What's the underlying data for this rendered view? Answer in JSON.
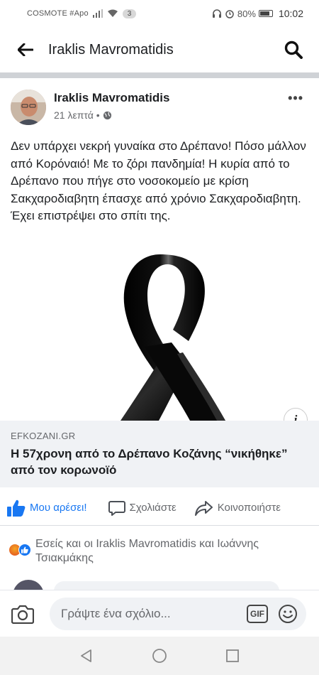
{
  "status_bar": {
    "carrier": "COSMOTE #Apo",
    "notification_count": "3",
    "battery": "80%",
    "time": "10:02"
  },
  "header": {
    "title": "Iraklis Mavromatidis"
  },
  "post": {
    "author": "Iraklis Mavromatidis",
    "time_ago": "21 λεπτά",
    "separator": "•",
    "privacy_icon": "globe-icon",
    "more_label": "•••",
    "text": "Δεν υπάρχει νεκρή γυναίκα στο Δρέπανο! Πόσο μάλλον από Κορόναιό! Με το ζόρι πανδημία! Η κυρία από το Δρέπανο που πήγε στο νοσοκομείο με κρίση Σακχαροδιαβητη έπασχε από χρόνιο Σακχαροδιαβητη. Έχει επιστρέψει στο σπίτι της.",
    "image": "black-mourning-ribbon",
    "info_label": "i",
    "link": {
      "source": "EFKOZANI.GR",
      "title": "Η 57χρονη από το Δρέπανο Κοζάνης “νικήθηκε” από τον κορωνοϊό"
    }
  },
  "actions": {
    "like": "Μου αρέσει!",
    "comment": "Σχολιάστε",
    "share": "Κοινοποιήστε"
  },
  "reactions": {
    "icons": [
      "angry-reaction",
      "like-reaction"
    ],
    "text": "Εσείς και οι Iraklis Mavromatidis και Ιωάννης Τσιακμάκης"
  },
  "composer": {
    "placeholder": "Γράψτε ένα σχόλιο...",
    "gif_label": "GIF"
  },
  "colors": {
    "accent": "#1877f2",
    "secondary_text": "#65676b",
    "preview_bg": "#f0f2f5"
  }
}
